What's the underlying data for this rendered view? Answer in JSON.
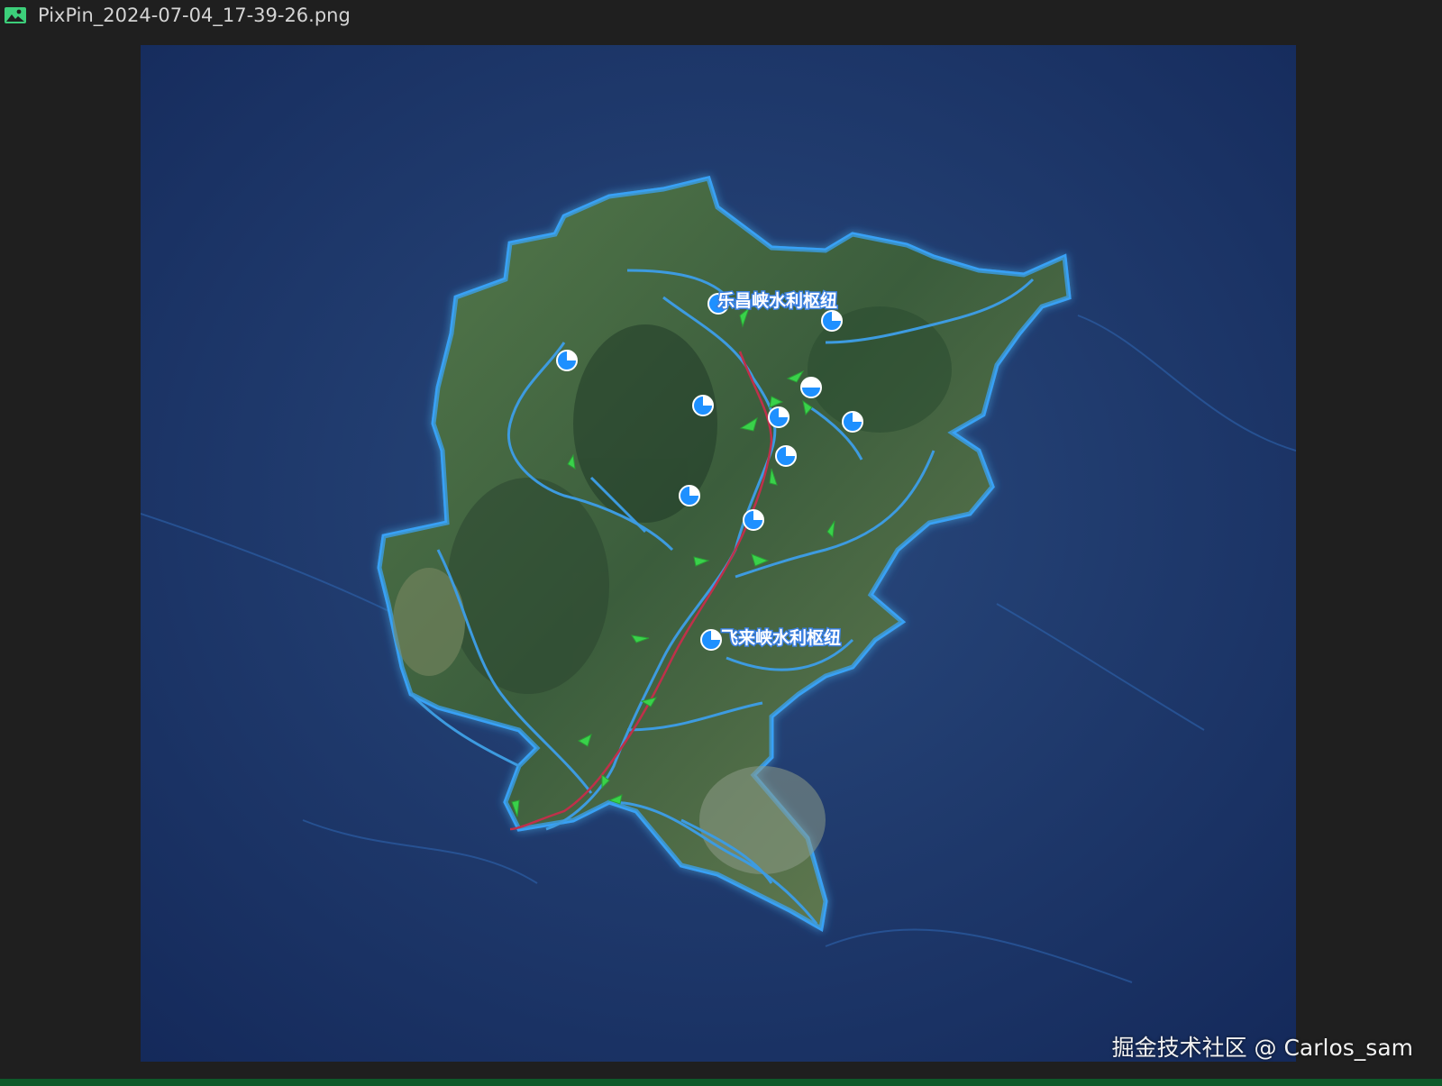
{
  "window": {
    "title": "PixPin_2024-07-04_17-39-26.png",
    "file_icon": "image-file-icon"
  },
  "map": {
    "labels": {
      "upper_hub": "乐昌峡水利枢纽",
      "lower_hub": "飞来峡水利枢纽"
    },
    "colors": {
      "sea": "#1a3566",
      "land_dark": "#2c4a36",
      "land": "#4b6a45",
      "boundary": "#e6a126",
      "glow": "#39a6ff",
      "river": "#3d9be0",
      "main_channel": "#c0304a",
      "marker": "#1e90ff",
      "gate": "#39d24a"
    },
    "marker_icon": "reservoir-station-icon",
    "gate_icon": "sluice-gate-icon"
  },
  "watermark": "掘金技术社区 @ Carlos_sam"
}
